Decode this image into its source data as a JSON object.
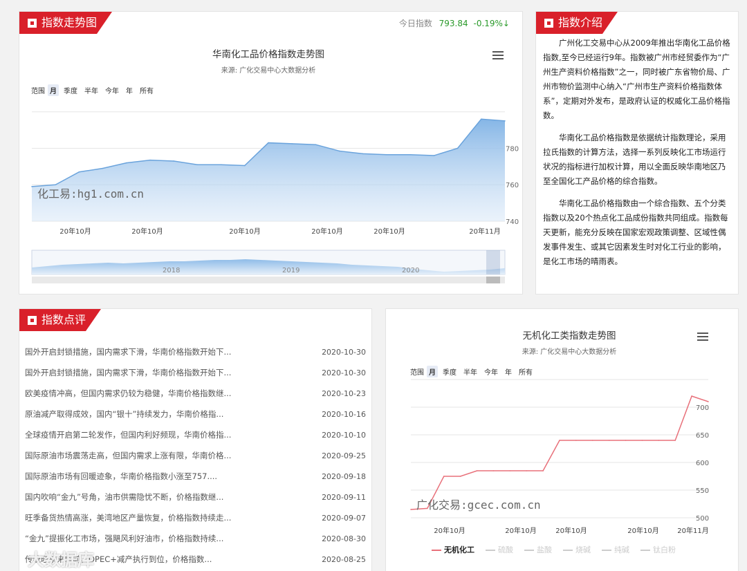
{
  "trend_panel": {
    "title": "指数走势图",
    "today_label": "今日指数",
    "today_value": "793.84",
    "today_change": "-0.19%↓",
    "chart_title": "华南化工品价格指数走势图",
    "chart_subtitle": "来源: 广化交易中心大数据分析",
    "range_label": "范围",
    "range_buttons": [
      "月",
      "季度",
      "半年",
      "今年",
      "年",
      "所有"
    ],
    "watermark": "化工易:hg1.com.cn",
    "y_ticks": [
      "780",
      "760",
      "740"
    ],
    "x_ticks": [
      "20年10月",
      "20年10月",
      "20年10月",
      "20年10月",
      "20年10月",
      "20年11月"
    ],
    "navigator_years": [
      "2018",
      "2019",
      "2020"
    ]
  },
  "intro_panel": {
    "title": "指数介绍",
    "paragraphs": [
      "广州化工交易中心从2009年推出华南化工品价格指数,至今已经运行9年。指数被广州市经贸委作为“广州生产资料价格指数”之一，同时被广东省物价局、广州市物价监测中心纳入“广州市生产资料价格指数体系”，定期对外发布，是政府认证的权威化工品价格指数。",
      "华南化工品价格指数是依据统计指数理论，采用拉氏指数的计算方法，选择一系列反映化工市场运行状况的指标进行加权计算，用以全面反映华南地区乃至全国化工产品价格的综合指数。",
      "华南化工品价格指数由一个综合指数、五个分类指数以及20个热点化工品成份指数共同组成。指数每天更新，能充分反映在国家宏观政策调整、区域性偶发事件发生、或其它因素发生时对化工行业的影响，是化工市场的晴雨表。"
    ]
  },
  "review_panel": {
    "title": "指数点评",
    "items": [
      {
        "title": "国外开启封锁措施，国内需求下滑，华南价格指数开始下...",
        "date": "2020-10-30"
      },
      {
        "title": "国外开启封锁措施，国内需求下滑，华南价格指数开始下...",
        "date": "2020-10-30"
      },
      {
        "title": "欧美疫情冲高，但国内需求仍较为稳健，华南价格指数继...",
        "date": "2020-10-23"
      },
      {
        "title": "原油减产取得成效，国内“银十”持续发力，华南价格指...",
        "date": "2020-10-16"
      },
      {
        "title": "全球疫情开启第二轮发作，但国内利好频现，华南价格指...",
        "date": "2020-10-10"
      },
      {
        "title": "国际原油市场震荡走高，但国内需求上涨有限，华南价格...",
        "date": "2020-09-25"
      },
      {
        "title": "国际原油市场有回暖迹象，华南价格指数小涨至757....",
        "date": "2020-09-18"
      },
      {
        "title": "国内吹响“金九”号角，油市供需隐忧不断，价格指数继...",
        "date": "2020-09-11"
      },
      {
        "title": "旺季备货热情高涨，美湾地区产量恢复，价格指数持续走...",
        "date": "2020-09-07"
      },
      {
        "title": "“金九”提振化工市场，强飓风利好油市，价格指数持续...",
        "date": "2020-08-30"
      },
      {
        "title": "传统旺季来临前，OPEC+减产执行到位，价格指数...",
        "date": "2020-08-25"
      }
    ]
  },
  "inorganic_panel": {
    "chart_title": "无机化工类指数走势图",
    "chart_subtitle": "来源: 广化交易中心大数据分析",
    "range_label": "范围",
    "range_buttons": [
      "月",
      "季度",
      "半年",
      "今年",
      "年",
      "所有"
    ],
    "watermark": "广化交易:gcec.com.cn",
    "y_ticks": [
      "700",
      "650",
      "600",
      "550",
      "500"
    ],
    "x_ticks": [
      "20年10月",
      "20年10月",
      "20年10月",
      "20年10月",
      "20年11月"
    ],
    "legend": [
      {
        "name": "无机化工",
        "active": true,
        "color": "#e8707a"
      },
      {
        "name": "硫酸",
        "active": false,
        "color": "#ccc"
      },
      {
        "name": "盐酸",
        "active": false,
        "color": "#ccc"
      },
      {
        "name": "烧碱",
        "active": false,
        "color": "#ccc"
      },
      {
        "name": "纯碱",
        "active": false,
        "color": "#ccc"
      },
      {
        "name": "钛白粉",
        "active": false,
        "color": "#ccc"
      }
    ]
  },
  "footer_watermark": "大数据库",
  "chart_data": [
    {
      "type": "area",
      "title": "华南化工品价格指数走势图",
      "subtitle": "来源: 广化交易中心大数据分析",
      "ylim": [
        740,
        798
      ],
      "y": [
        759,
        760,
        767,
        769,
        772,
        773.5,
        773,
        771,
        771,
        770.5,
        783,
        782.5,
        782,
        778.5,
        777,
        776.5,
        776.5,
        776,
        780,
        796,
        795
      ],
      "x_tick_labels": [
        "20年10月",
        "20年10月",
        "20年10月",
        "20年10月",
        "20年10月",
        "20年11月"
      ],
      "grid": true,
      "color": "#7fb2e5"
    },
    {
      "type": "line",
      "title": "无机化工类指数走势图",
      "subtitle": "来源: 广化交易中心大数据分析",
      "ylim": [
        490,
        740
      ],
      "series": [
        {
          "name": "无机化工",
          "values": [
            515,
            517,
            575,
            575,
            585,
            585,
            585,
            585,
            585,
            640,
            640,
            640,
            640,
            640,
            640,
            640,
            640,
            720,
            710
          ],
          "color": "#e8707a"
        }
      ],
      "x_tick_labels": [
        "20年10月",
        "20年10月",
        "20年10月",
        "20年10月",
        "20年11月"
      ],
      "grid": true
    }
  ]
}
